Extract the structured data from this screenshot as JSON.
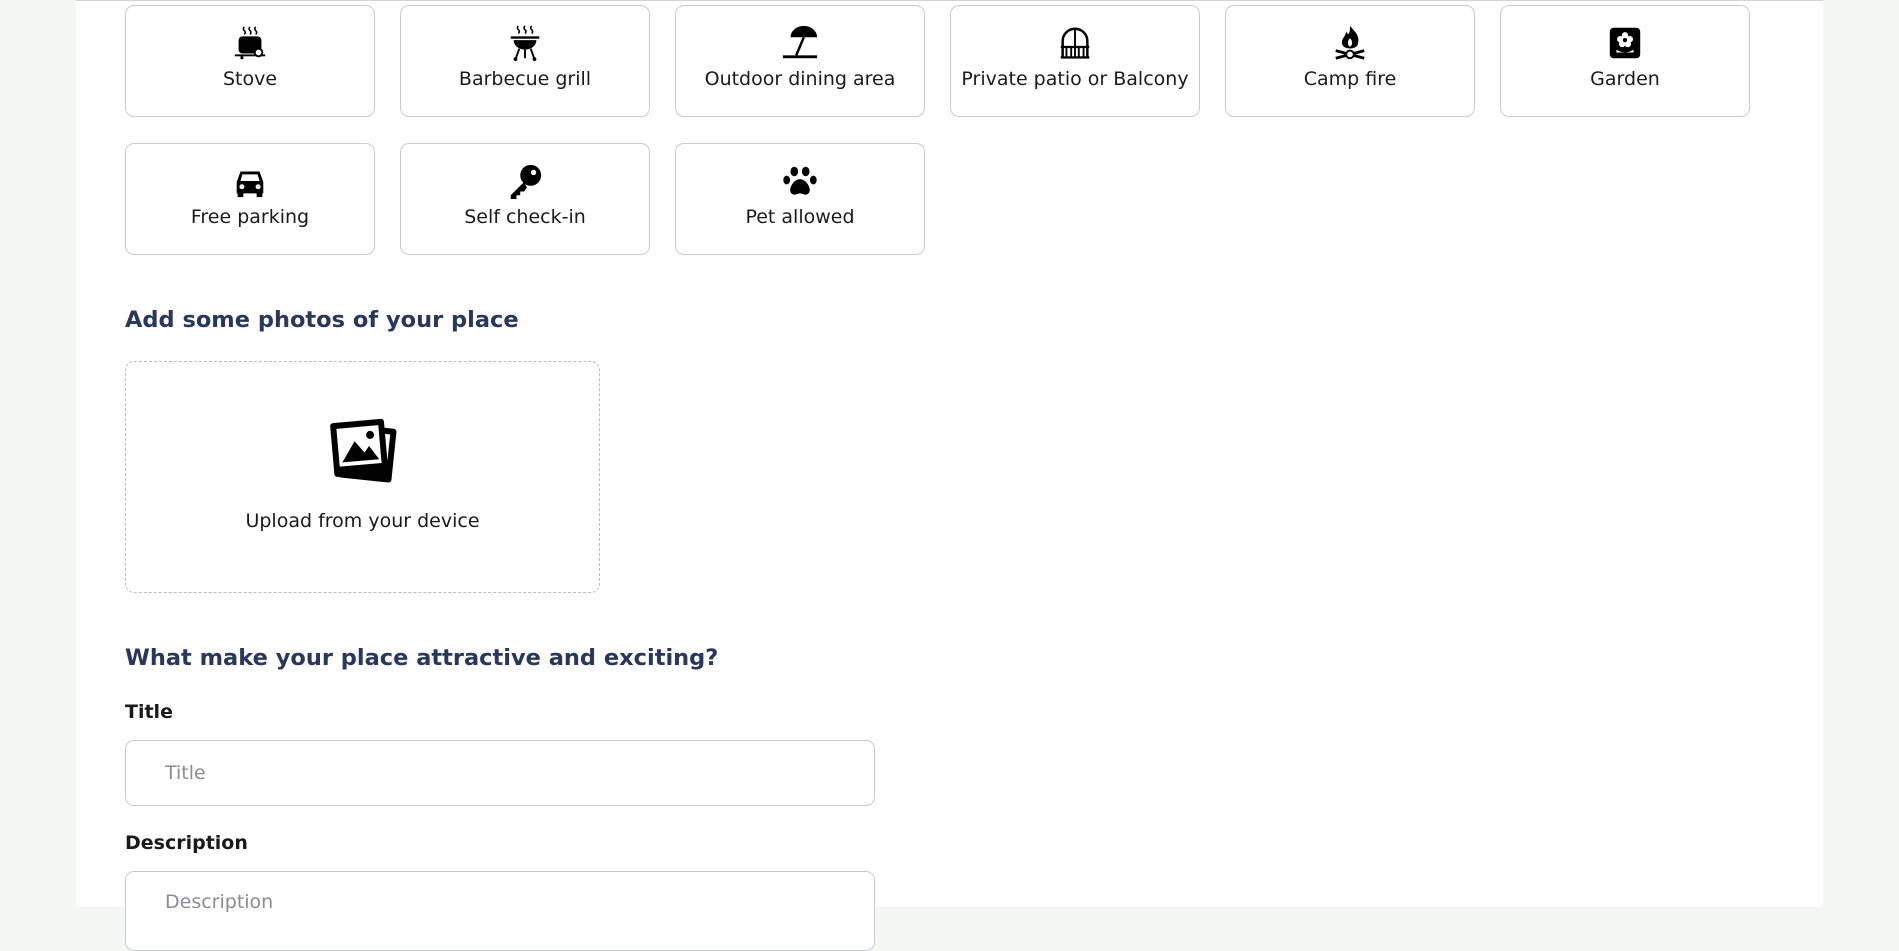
{
  "amenities": [
    {
      "label": "Stove",
      "icon": "stove-icon"
    },
    {
      "label": "Barbecue grill",
      "icon": "barbecue-grill-icon"
    },
    {
      "label": "Outdoor dining area",
      "icon": "beach-umbrella-icon"
    },
    {
      "label": "Private patio or Balcony",
      "icon": "balcony-icon"
    },
    {
      "label": "Camp fire",
      "icon": "campfire-icon"
    },
    {
      "label": "Garden",
      "icon": "garden-flower-icon"
    },
    {
      "label": "Free parking",
      "icon": "car-icon"
    },
    {
      "label": "Self check-in",
      "icon": "key-icon"
    },
    {
      "label": "Pet allowed",
      "icon": "paw-icon"
    }
  ],
  "photos": {
    "heading": "Add some photos of your place",
    "upload_label": "Upload from your device",
    "icon": "photos-icon"
  },
  "details": {
    "heading": "What make your place attractive and exciting?",
    "title_label": "Title",
    "title_placeholder": "Title",
    "description_label": "Description",
    "description_placeholder": "Description"
  },
  "colors": {
    "heading": "#28375a",
    "card_border": "#c8cbcf",
    "page_background": "#f4f6f4"
  }
}
